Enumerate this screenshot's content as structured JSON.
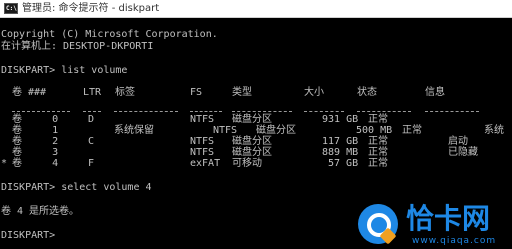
{
  "window": {
    "title": "管理员: 命令提示符 - diskpart",
    "icon": "cmd-icon"
  },
  "console": {
    "copyright": "Copyright (C) Microsoft Corporation.",
    "computer": "在计算机上: DESKTOP-DKPORTI",
    "cmd1": "DISKPART> list volume",
    "headers": {
      "vol": "卷 ###",
      "ltr": "LTR",
      "label": "标签",
      "fs": "FS",
      "type": "类型",
      "size": "大小",
      "status": "状态",
      "info": "信息"
    },
    "rows": [
      {
        "vol": "卷     0",
        "ltr": "D",
        "label": "",
        "fs": "NTFS",
        "type": "磁盘分区",
        "size": "931 GB",
        "status": "正常",
        "info": ""
      },
      {
        "vol": "卷     1",
        "ltr": "",
        "label": "系统保留",
        "fs": "NTFS",
        "type": "磁盘分区",
        "size": "500 MB",
        "status": "正常",
        "info": "系统"
      },
      {
        "vol": "卷     2",
        "ltr": "C",
        "label": "",
        "fs": "NTFS",
        "type": "磁盘分区",
        "size": "117 GB",
        "status": "正常",
        "info": "启动"
      },
      {
        "vol": "卷     3",
        "ltr": "",
        "label": "",
        "fs": "NTFS",
        "type": "磁盘分区",
        "size": "889 MB",
        "status": "正常",
        "info": "已隐藏"
      },
      {
        "vol": "卷     4",
        "ltr": "F",
        "label": "",
        "fs": "exFAT",
        "type": "可移动",
        "size": "57 GB",
        "status": "正常",
        "info": ""
      }
    ],
    "cmd2": "DISKPART> select volume 4",
    "result": "卷 4 是所选卷。",
    "prompt": "DISKPART> "
  },
  "watermark": {
    "brand": "恰卡网",
    "url": "www.qiaqa.com",
    "color": "#1e88e5"
  }
}
